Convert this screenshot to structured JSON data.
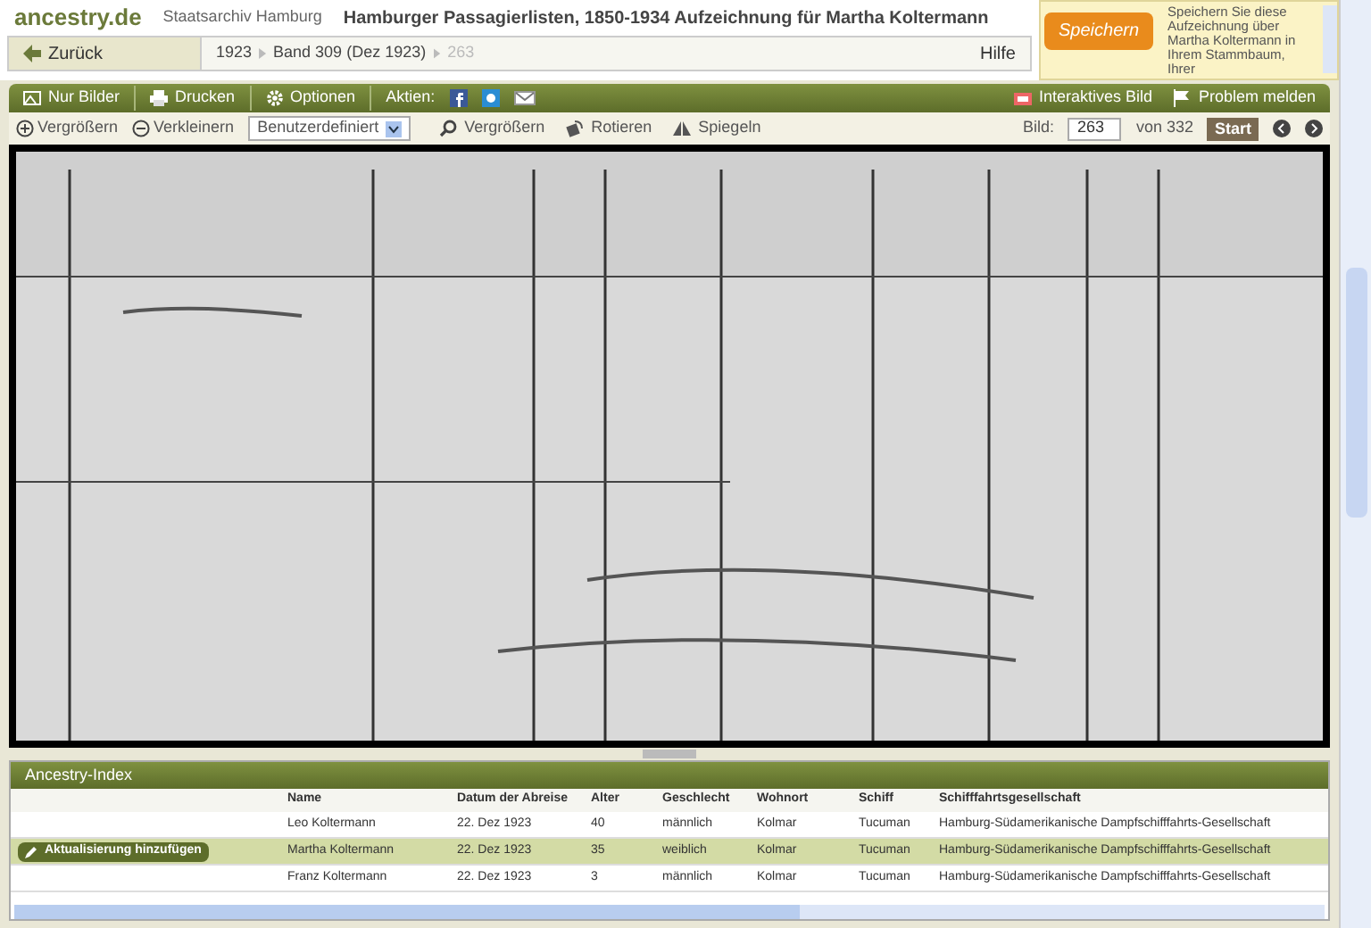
{
  "header": {
    "logo": "ancestry.de",
    "archive": "Staatsarchiv Hamburg",
    "title": "Hamburger Passagierlisten, 1850-1934 Aufzeichnung für Martha Koltermann",
    "back": "Zurück",
    "breadcrumbs": [
      {
        "label": "1923",
        "current": false
      },
      {
        "label": "Band 309 (Dez 1923)",
        "current": false
      },
      {
        "label": "263",
        "current": true
      }
    ],
    "help": "Hilfe"
  },
  "save_panel": {
    "button": "Speichern",
    "text": "Speichern Sie diese Aufzeichnung über Martha Koltermann in Ihrem Stammbaum, Ihrer"
  },
  "toolbar": {
    "left": [
      {
        "label": "Nur Bilder",
        "kind": "images"
      },
      {
        "label": "Drucken",
        "kind": "print"
      },
      {
        "label": "Optionen",
        "kind": "options"
      }
    ],
    "actions_label": "Aktien:",
    "right": [
      {
        "label": "Interaktives Bild",
        "kind": "interactive"
      },
      {
        "label": "Problem melden",
        "kind": "flag"
      }
    ]
  },
  "subtoolbar": {
    "zoom_in": "Vergrößern",
    "zoom_out": "Verkleinern",
    "preset": "Benutzerdefiniert",
    "tools": [
      {
        "label": "Vergrößern",
        "kind": "magnifier"
      },
      {
        "label": "Rotieren",
        "kind": "rotate"
      },
      {
        "label": "Spiegeln",
        "kind": "mirror"
      }
    ],
    "image_label": "Bild:",
    "image_number": "263",
    "of": "von 332",
    "start": "Start"
  },
  "index": {
    "title": "Ancestry-Index",
    "update_button": "Aktualisierung hinzufügen",
    "columns": [
      "Name",
      "Datum der Abreise",
      "Alter",
      "Geschlecht",
      "Wohnort",
      "Schiff",
      "Schifffahrtsgesellschaft"
    ],
    "rows": [
      {
        "selected": false,
        "cells": [
          "Leo Koltermann",
          "22. Dez 1923",
          "40",
          "männlich",
          "Kolmar",
          "Tucuman",
          "Hamburg-Südamerikanische Dampfschifffahrts-Gesellschaft"
        ]
      },
      {
        "selected": true,
        "cells": [
          "Martha Koltermann",
          "22. Dez 1923",
          "35",
          "weiblich",
          "Kolmar",
          "Tucuman",
          "Hamburg-Südamerikanische Dampfschifffahrts-Gesellschaft"
        ]
      },
      {
        "selected": false,
        "cells": [
          "Franz Koltermann",
          "22. Dez 1923",
          "3",
          "männlich",
          "Kolmar",
          "Tucuman",
          "Hamburg-Südamerikanische Dampfschifffahrts-Gesellschaft"
        ]
      }
    ]
  }
}
